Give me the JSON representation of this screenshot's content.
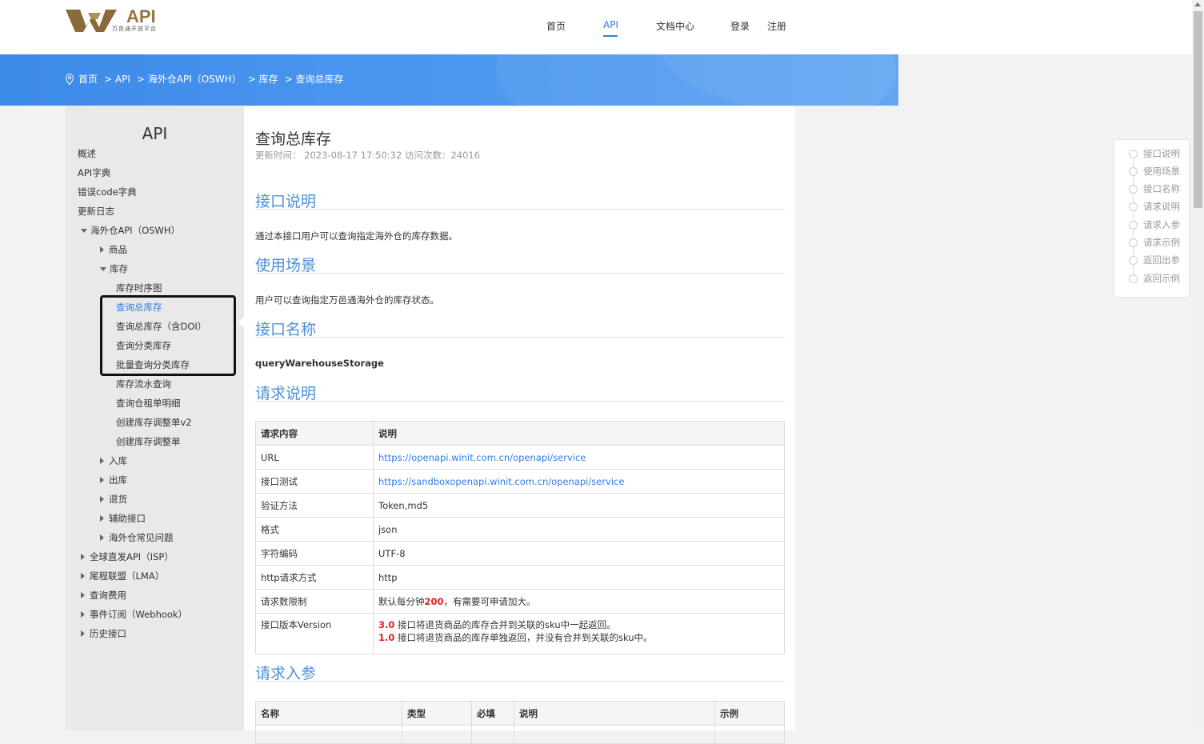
{
  "header": {
    "logo_text": "API",
    "logo_sub": "万邑通开放平台",
    "nav": [
      "首页",
      "API",
      "文档中心",
      "登录",
      "注册"
    ],
    "nav_active": "API"
  },
  "breadcrumb": [
    "首页",
    "> API",
    "> 海外仓API（OSWH）",
    "> 库存",
    "> 查询总库存"
  ],
  "sidebar": {
    "title": "API",
    "items": [
      "概述",
      "API字典",
      "错误code字典",
      "更新日志",
      "海外仓API（OSWH）",
      "商品",
      "库存",
      "库存时序图",
      "查询总库存",
      "查询总库存（含DOI）",
      "查询分类库存",
      "批量查询分类库存",
      "库存流水查询",
      "查询仓租单明细",
      "创建库存调整单v2",
      "创建库存调整单",
      "入库",
      "出库",
      "退货",
      "辅助接口",
      "海外仓常见问题",
      "全球直发API（ISP）",
      "尾程联盟（LMA）",
      "查询费用",
      "事件订阅（Webhook）",
      "历史接口"
    ],
    "active": "查询总库存"
  },
  "doc": {
    "title": "查询总库存",
    "meta": "更新时间：  2023-08-17 17:50:32    访问次数：24016",
    "sections": {
      "intro_title": "接口说明",
      "intro_text": "通过本接口用户可以查询指定海外仓的库存数据。",
      "scene_title": "使用场景",
      "scene_text": "用户可以查询指定万邑通海外仓的库存状态。",
      "name_title": "接口名称",
      "name_value": "queryWarehouseStorage",
      "request_title": "请求说明",
      "params_title": "请求入参"
    },
    "request_table": {
      "headers": [
        "请求内容",
        "说明"
      ],
      "rows": [
        [
          "URL",
          "https://openapi.winit.com.cn/openapi/service"
        ],
        [
          "接口测试",
          "https://sandboxopenapi.winit.com.cn/openapi/service"
        ],
        [
          "验证方法",
          "Token,md5"
        ],
        [
          "格式",
          "json"
        ],
        [
          "字符编码",
          "UTF-8"
        ],
        [
          "http请求方式",
          "http"
        ]
      ],
      "limit_label": "请求数限制",
      "limit_pre": "默认每分钟",
      "limit_num": "200",
      "limit_post": "，有需要可申请加大。",
      "version_label": "接口版本Version",
      "version_1_num": "3.0",
      "version_1_text": " 接口将退货商品的库存合并到关联的sku中一起返回。",
      "version_2_num": "1.0",
      "version_2_text": " 接口将退货商品的库存单独返回，并没有合并到关联的sku中。"
    },
    "params_table": {
      "headers": [
        "名称",
        "类型",
        "必填",
        "说明",
        "示例"
      ]
    }
  },
  "toc": [
    "接口说明",
    "使用场景",
    "接口名称",
    "请求说明",
    "请求入参",
    "请求示例",
    "返回出参",
    "返回示例"
  ],
  "colors": {
    "accent": "#2d7ee0",
    "banner": "#4b96ef",
    "section_title": "#4a90d9",
    "highlight": "#e02020"
  }
}
